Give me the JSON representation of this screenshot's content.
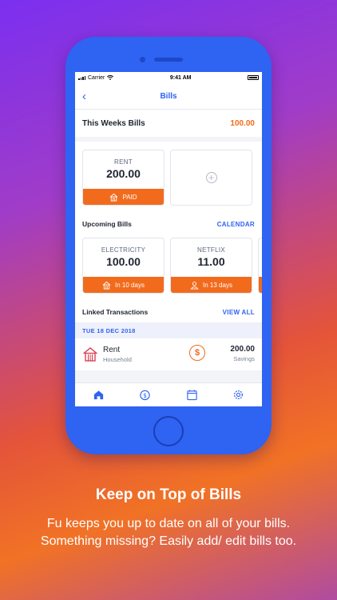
{
  "status_bar": {
    "carrier": "Carrier",
    "time": "9:41 AM"
  },
  "nav": {
    "title": "Bills",
    "back_icon": "chevron-left-icon"
  },
  "this_week": {
    "label": "This Weeks Bills",
    "amount": "100.00",
    "cards": [
      {
        "category": "RENT",
        "value": "200.00",
        "tag": "PAID",
        "icon": "house-icon"
      }
    ],
    "add_icon": "plus-circle-icon"
  },
  "upcoming": {
    "label": "Upcoming Bills",
    "link": "CALENDAR",
    "cards": [
      {
        "category": "ELECTRICITY",
        "value": "100.00",
        "tag": "In 10 days",
        "icon": "house-icon"
      },
      {
        "category": "NETFLIX",
        "value": "11.00",
        "tag": "In 13 days",
        "icon": "person-icon"
      }
    ]
  },
  "linked": {
    "label": "Linked Transactions",
    "link": "VIEW ALL",
    "date": "TUE 18 DEC 2018",
    "transactions": [
      {
        "name": "Rent",
        "category": "Household",
        "amount": "200.00",
        "account": "Savings"
      }
    ]
  },
  "tabbar": {
    "icons": [
      "home-icon",
      "money-icon",
      "calendar-icon",
      "settings-icon"
    ]
  },
  "colors": {
    "accent": "#2f63f2",
    "orange": "#f26b1d"
  },
  "promo": {
    "headline": "Keep on Top of Bills",
    "description": "Fu keeps you up to date on all of your bills. Something missing? Easily add/ edit bills too."
  }
}
